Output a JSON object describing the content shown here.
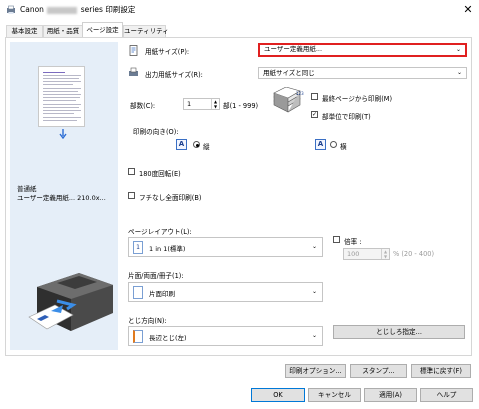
{
  "window": {
    "title_prefix": "Canon",
    "title_suffix": "series 印刷設定",
    "close_label": "✕"
  },
  "tabs": [
    {
      "label": "基本設定"
    },
    {
      "label": "用紙・品質"
    },
    {
      "label": "ページ設定"
    },
    {
      "label": "ユーティリティ"
    }
  ],
  "preview": {
    "media_line1": "普通紙",
    "media_line2": "ユーザー定義用紙... 210.0x..."
  },
  "page_size": {
    "label": "用紙サイズ(P):",
    "value": "ユーザー定義用紙...",
    "highlight": "#e02020"
  },
  "output_size": {
    "label": "出力用紙サイズ(R):",
    "value": "用紙サイズと同じ"
  },
  "copies": {
    "label": "部数(C):",
    "value": "1",
    "range": "部(1 - 999)",
    "last_page_first": "最終ページから印刷(M)",
    "collate": "部単位で印刷(T)"
  },
  "orientation": {
    "label": "印刷の向き(O):",
    "portrait": "縦",
    "landscape": "横"
  },
  "rotate180": {
    "label": "180度回転(E)"
  },
  "borderless": {
    "label": "フチなし全面印刷(B)"
  },
  "page_layout": {
    "label": "ページレイアウト(L):",
    "value": "1 in 1(標準)"
  },
  "scale": {
    "label": "倍率 :",
    "value": "100",
    "range": "% (20 - 400)"
  },
  "duplex": {
    "label": "片面/両面/冊子(1):",
    "value": "片面印刷"
  },
  "binding": {
    "label": "とじ方向(N):",
    "value": "長辺とじ(左)",
    "margin_button": "とじしろ指定..."
  },
  "bottom_buttons": {
    "print_options": "印刷オプション...",
    "stamp": "スタンプ...",
    "defaults": "標準に戻す(F)"
  },
  "dialog_buttons": {
    "ok": "OK",
    "cancel": "キャンセル",
    "apply": "適用(A)",
    "help": "ヘルプ"
  }
}
